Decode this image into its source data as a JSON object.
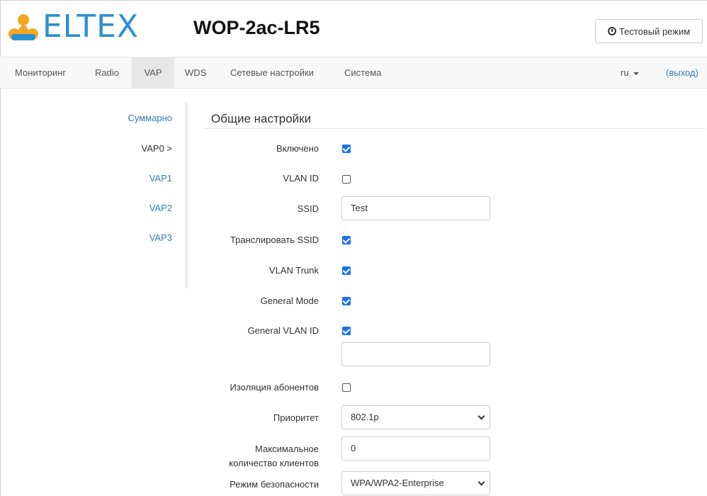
{
  "header": {
    "logo_text": "ELTEX",
    "device_name": "WOP-2ac-LR5",
    "test_mode_label": "Тестовый режим"
  },
  "nav": {
    "items": [
      "Мониторинг",
      "Radio",
      "VAP",
      "WDS",
      "Сетевые настройки",
      "Система"
    ],
    "active": "VAP",
    "language": "ru",
    "logout_label": "(выход)"
  },
  "sidemenu": {
    "items": [
      "Суммарно",
      "VAP0 >",
      "VAP1",
      "VAP2",
      "VAP3"
    ],
    "current": "VAP0 >"
  },
  "form": {
    "section_title": "Общие настройки",
    "enabled_label": "Включено",
    "enabled": true,
    "vlan_id_label": "VLAN ID",
    "vlan_id": false,
    "ssid_label": "SSID",
    "ssid_value": "Test",
    "broadcast_ssid_label": "Транслировать SSID",
    "broadcast_ssid": true,
    "vlan_trunk_label": "VLAN Trunk",
    "vlan_trunk": true,
    "general_mode_label": "General Mode",
    "general_mode": true,
    "general_vlan_id_label": "General VLAN ID",
    "general_vlan_id": true,
    "general_vlan_id_value": "",
    "isolation_label": "Изоляция абонентов",
    "isolation": false,
    "priority_label": "Приоритет",
    "priority_value": "802.1p",
    "max_clients_label_line1": "Максимальное",
    "max_clients_label_line2": "количество клиентов",
    "max_clients_value": "0",
    "security_mode_label": "Режим безопасности",
    "security_mode_value": "WPA/WPA2-Enterprise"
  },
  "colors": {
    "brand": "#2b8fd1",
    "link": "#337ab7",
    "checkbox": "#1a73e8"
  }
}
